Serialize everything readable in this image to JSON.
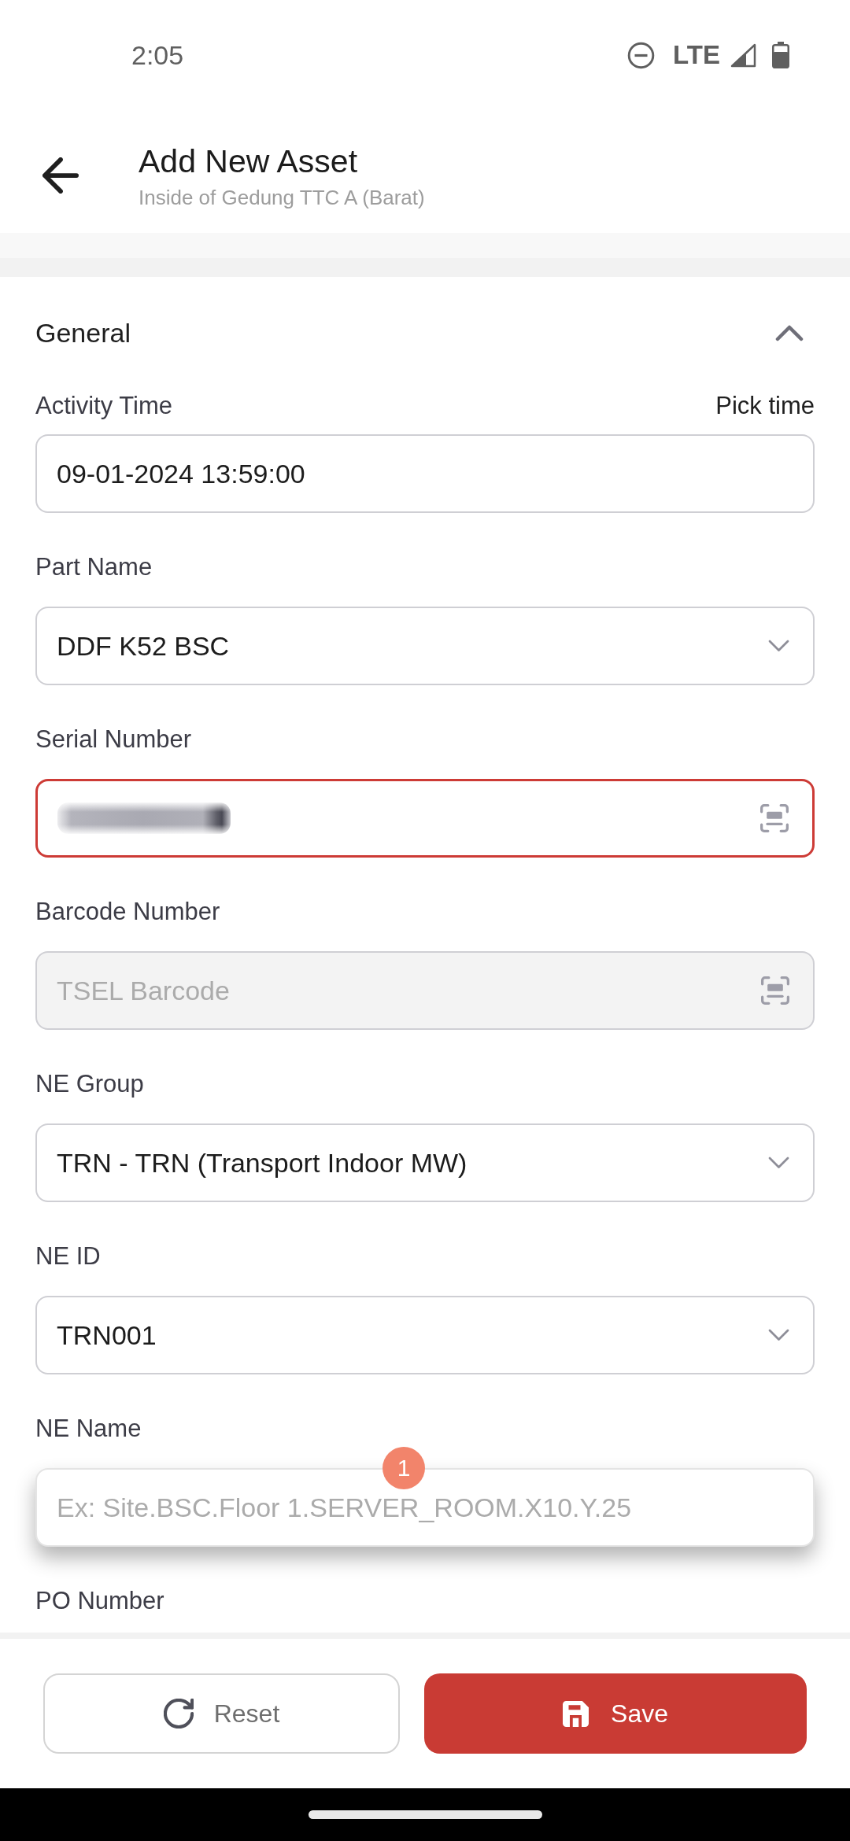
{
  "status_bar": {
    "time": "2:05",
    "network": "LTE"
  },
  "header": {
    "title": "Add New Asset",
    "subtitle": "Inside of Gedung TTC A (Barat)"
  },
  "section": {
    "title": "General",
    "expanded": true,
    "fields": [
      {
        "kind": "text",
        "label": "Activity Time",
        "action": "Pick time",
        "value": "09-01-2024 13:59:00",
        "focused": false,
        "disabled": false,
        "blurred": false,
        "highlighted": false
      },
      {
        "kind": "select",
        "label": "Part Name",
        "value": "DDF K52 BSC",
        "focused": false,
        "disabled": false,
        "blurred": false,
        "highlighted": false
      },
      {
        "kind": "scan",
        "label": "Serial Number",
        "focused": true,
        "disabled": false,
        "blurred": true,
        "highlighted": false
      },
      {
        "kind": "scan",
        "label": "Barcode Number",
        "placeholder": "TSEL Barcode",
        "focused": false,
        "disabled": true,
        "blurred": false,
        "highlighted": false
      },
      {
        "kind": "select",
        "label": "NE Group",
        "value": "TRN - TRN (Transport Indoor MW)",
        "focused": false,
        "disabled": false,
        "blurred": false,
        "highlighted": false
      },
      {
        "kind": "select",
        "label": "NE ID",
        "value": "TRN001",
        "focused": false,
        "disabled": false,
        "blurred": false,
        "highlighted": false
      },
      {
        "kind": "text",
        "label": "NE Name",
        "placeholder": "Ex: Site.BSC.Floor 1.SERVER_ROOM.X10.Y.25",
        "badge": "1",
        "focused": false,
        "disabled": false,
        "blurred": false,
        "highlighted": true
      },
      {
        "kind": "label",
        "label": "PO Number"
      }
    ]
  },
  "buttons": [
    {
      "kind": "reset",
      "label": "Reset"
    },
    {
      "kind": "save",
      "label": "Save"
    }
  ]
}
